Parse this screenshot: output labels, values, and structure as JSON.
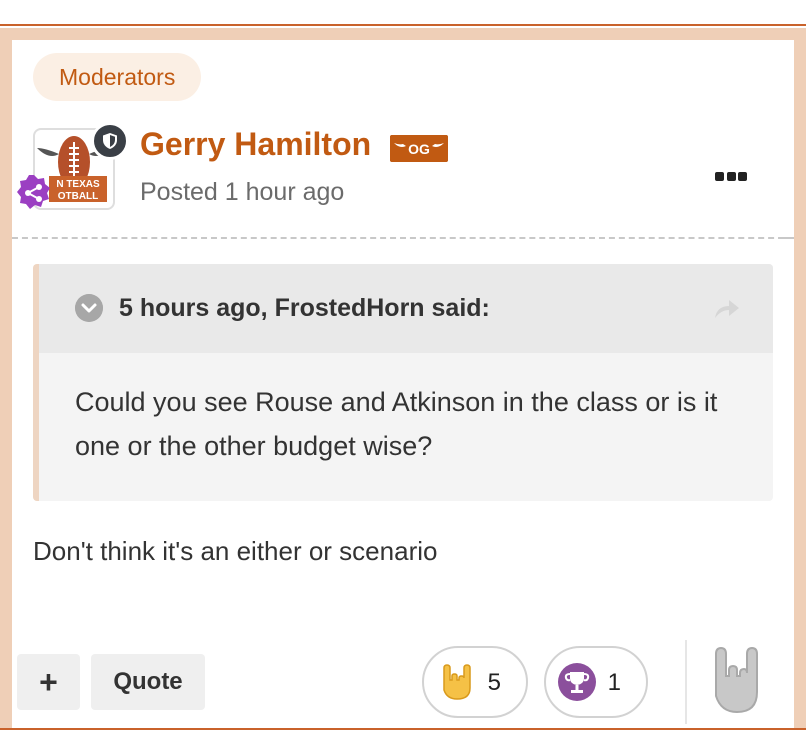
{
  "post": {
    "group_badge": "Moderators",
    "author": {
      "name": "Gerry Hamilton",
      "avatar_text": [
        "N TEXAS",
        "OTBALL"
      ],
      "og_badge_text": "OG"
    },
    "posted": "Posted 1 hour ago",
    "quote": {
      "citation": "5 hours ago, FrostedHorn said:",
      "text": "Could you see Rouse and Atkinson in the class or is it one or the other budget wise?"
    },
    "body": "Don't think it's an either or scenario"
  },
  "actions": {
    "plus_label": "+",
    "quote_label": "Quote"
  },
  "reactions": [
    {
      "icon": "horns-hand-icon",
      "count": "5"
    },
    {
      "icon": "trophy-icon",
      "count": "1"
    }
  ],
  "colors": {
    "accent": "#c15a12",
    "frame": "#efcfb7",
    "badge_bg": "#fbefe4",
    "trophy": "#8b4f9c",
    "horns": "#f5c146"
  }
}
